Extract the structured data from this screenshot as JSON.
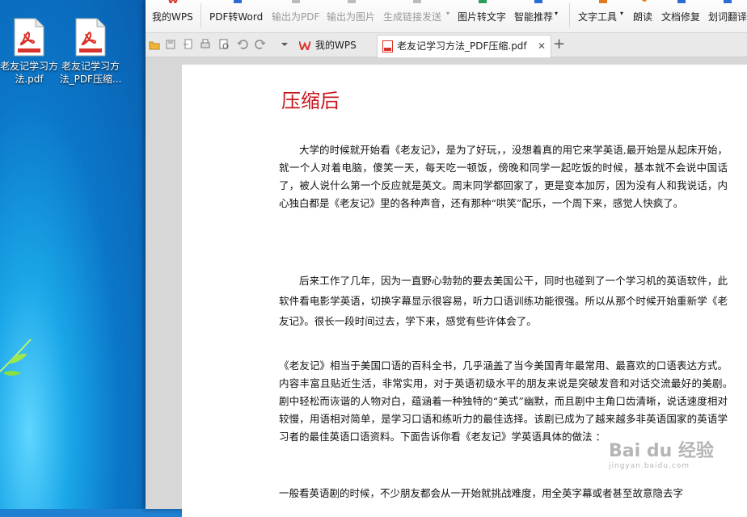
{
  "desktop": {
    "icons": [
      {
        "label": "老友记学习方法.pdf"
      },
      {
        "label": "老友记学习方法_PDF压缩..."
      }
    ]
  },
  "ribbon": {
    "items": [
      "我的WPS",
      "PDF转Word",
      "输出为PDF",
      "输出为图片",
      "生成链接发送",
      "图片转文字",
      "智能推荐",
      "文字工具",
      "朗读",
      "文档修复",
      "划词翻译"
    ]
  },
  "tabs": {
    "home": "我的WPS",
    "doc": "老友记学习方法_PDF压缩.pdf",
    "close": "✕",
    "add": "+"
  },
  "document": {
    "heading": "压缩后",
    "paragraphs": [
      "大学的时候就开始看《老友记》，是为了好玩，，没想着真的用它来学英语,最开始是从起床开始，就一个人对着电脑，傻笑一天，每天吃一顿饭，傍晚和同学一起吃饭的时候，基本就不会说中国话了，被人说什么第一个反应就是英文。周末同学都回家了，更是变本加厉，因为没有人和我说话，内心独白都是《老友记》里的各种声音，还有那种“哄笑”配乐，一个周下来，感觉人快疯了。",
      "后来工作了几年，因为一直野心勃勃的要去美国公干，同时也碰到了一个学习机的英语软件，此软件看电影学英语，切换字幕显示很容易，听力口语训练功能很强。所以从那个时候开始重新学《老友记》。很长一段时间过去，学下来，感觉有些许体会了。",
      "《老友记》相当于美国口语的百科全书，几乎涵盖了当今美国青年最常用、最喜欢的口语表达方式。内容丰富且贴近生活，非常实用，对于英语初级水平的朋友来说是突破发音和对话交流最好的美剧。　　剧中轻松而诙谐的人物对白，蕴涵着一种独特的“美式”幽默，而且剧中主角口齿清晰，说话速度相对较慢，用语相对简单，是学习口语和练听力的最佳选择。该剧已成为了越来越多非英语国家的英语学习者的最佳英语口语资料。下面告诉你看《老友记》学英语具体的做法 ：",
      "一般看英语剧的时候，不少朋友都会从一开始就挑战难度，用全英字幕或者甚至故意隐去字"
    ]
  },
  "watermark": {
    "brand": "Bai du 经验",
    "url": "jingyan.baidu.com"
  },
  "colors": {
    "heading": "#c8161d",
    "wps_red": "#d9342b"
  }
}
